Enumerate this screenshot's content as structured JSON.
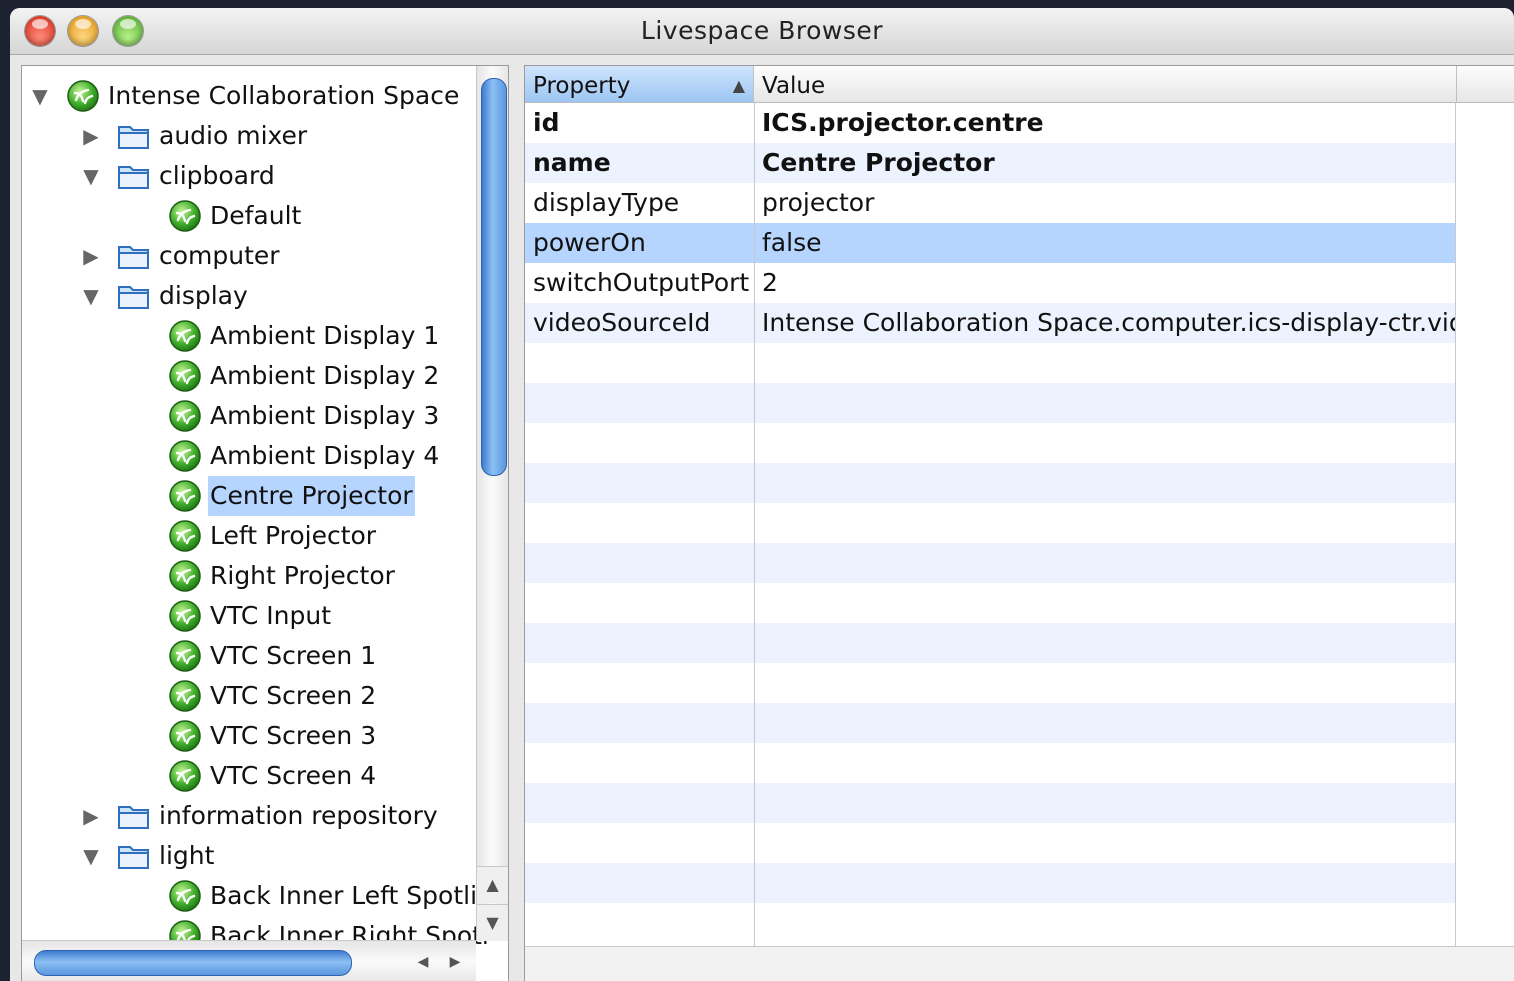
{
  "window": {
    "title": "Livespace Browser"
  },
  "tree": {
    "rows": [
      {
        "label": "Intense Collaboration Space",
        "level": 0,
        "kind": "node",
        "disclosure": "open"
      },
      {
        "label": "audio mixer",
        "level": 1,
        "kind": "folder",
        "disclosure": "closed"
      },
      {
        "label": "clipboard",
        "level": 1,
        "kind": "folder",
        "disclosure": "open"
      },
      {
        "label": "Default",
        "level": 2,
        "kind": "node",
        "disclosure": "none"
      },
      {
        "label": "computer",
        "level": 1,
        "kind": "folder",
        "disclosure": "closed"
      },
      {
        "label": "display",
        "level": 1,
        "kind": "folder",
        "disclosure": "open"
      },
      {
        "label": "Ambient Display 1",
        "level": 2,
        "kind": "node",
        "disclosure": "none"
      },
      {
        "label": "Ambient Display 2",
        "level": 2,
        "kind": "node",
        "disclosure": "none"
      },
      {
        "label": "Ambient Display 3",
        "level": 2,
        "kind": "node",
        "disclosure": "none"
      },
      {
        "label": "Ambient Display 4",
        "level": 2,
        "kind": "node",
        "disclosure": "none"
      },
      {
        "label": "Centre Projector",
        "level": 2,
        "kind": "node",
        "disclosure": "none",
        "selected": true
      },
      {
        "label": "Left Projector",
        "level": 2,
        "kind": "node",
        "disclosure": "none"
      },
      {
        "label": "Right Projector",
        "level": 2,
        "kind": "node",
        "disclosure": "none"
      },
      {
        "label": "VTC Input",
        "level": 2,
        "kind": "node",
        "disclosure": "none"
      },
      {
        "label": "VTC Screen 1",
        "level": 2,
        "kind": "node",
        "disclosure": "none"
      },
      {
        "label": "VTC Screen 2",
        "level": 2,
        "kind": "node",
        "disclosure": "none"
      },
      {
        "label": "VTC Screen 3",
        "level": 2,
        "kind": "node",
        "disclosure": "none"
      },
      {
        "label": "VTC Screen 4",
        "level": 2,
        "kind": "node",
        "disclosure": "none"
      },
      {
        "label": "information repository",
        "level": 1,
        "kind": "folder",
        "disclosure": "closed"
      },
      {
        "label": "light",
        "level": 1,
        "kind": "folder",
        "disclosure": "open"
      },
      {
        "label": "Back Inner Left Spotlig",
        "level": 2,
        "kind": "node",
        "disclosure": "none"
      },
      {
        "label": "Back Inner Right Spotl",
        "level": 2,
        "kind": "node",
        "disclosure": "none"
      }
    ]
  },
  "table": {
    "columns": [
      {
        "label": "Property",
        "sorted": true,
        "sort_direction": "ascending"
      },
      {
        "label": "Value",
        "sorted": false
      }
    ],
    "rows": [
      {
        "property": "id",
        "value": "ICS.projector.centre",
        "bold": true
      },
      {
        "property": "name",
        "value": "Centre Projector",
        "bold": true
      },
      {
        "property": "displayType",
        "value": "projector"
      },
      {
        "property": "powerOn",
        "value": "false",
        "selected": true
      },
      {
        "property": "switchOutputPort",
        "value": "2"
      },
      {
        "property": "videoSourceId",
        "value": "Intense Collaboration Space.computer.ics-display-ctr.vid"
      }
    ],
    "empty_row_count": 15
  },
  "colors": {
    "selection": "#b5d5ff",
    "stripe": "#edf3fe",
    "scroll_thumb": "#5a97e0"
  }
}
